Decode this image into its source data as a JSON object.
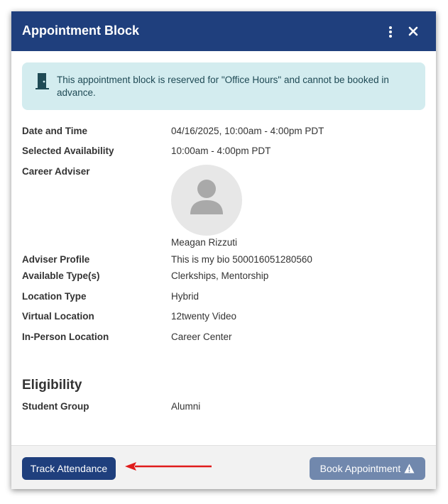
{
  "modal": {
    "title": "Appointment Block",
    "more_icon": "kebab-vertical-icon",
    "close_icon": "close-icon"
  },
  "notice": {
    "icon": "door-icon",
    "text": "This appointment block is reserved for \"Office Hours\" and cannot be booked in advance.",
    "bg_color": "#d3ecef"
  },
  "details": {
    "date_time": {
      "label": "Date and Time",
      "value": "04/16/2025, 10:00am - 4:00pm PDT"
    },
    "availability": {
      "label": "Selected Availability",
      "value": "10:00am - 4:00pm PDT"
    },
    "adviser": {
      "label": "Career Adviser",
      "name": "Meagan Rizzuti",
      "avatar_icon": "user-avatar-icon"
    },
    "profile": {
      "label": "Adviser Profile",
      "value": "This is my bio 500016051280560"
    },
    "types": {
      "label": "Available Type(s)",
      "value": "Clerkships, Mentorship"
    },
    "location_type": {
      "label": "Location Type",
      "value": "Hybrid"
    },
    "virtual_location": {
      "label": "Virtual Location",
      "value": "12twenty Video"
    },
    "in_person_location": {
      "label": "In-Person Location",
      "value": "Career Center"
    }
  },
  "eligibility": {
    "title": "Eligibility",
    "student_group": {
      "label": "Student Group",
      "value": "Alumni"
    }
  },
  "footer": {
    "track_label": "Track Attendance",
    "book_label": "Book Appointment",
    "book_icon": "warning-icon"
  },
  "colors": {
    "header": "#1f3f7d",
    "primary_button": "#1f3f7d",
    "disabled_button": "#7188ad",
    "annotation_arrow": "#e01c1c"
  }
}
